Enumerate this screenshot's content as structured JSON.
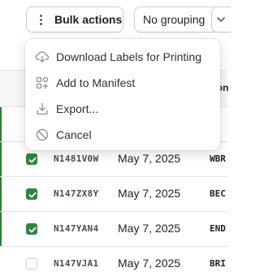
{
  "toolbar": {
    "bulk_actions_label": "Bulk actions",
    "grouping_label": "No grouping"
  },
  "menu": {
    "items": [
      {
        "label": "Download Labels for Printing",
        "icon": "download-cloud-icon"
      },
      {
        "label": "Add to Manifest",
        "icon": "manifest-grid-icon"
      },
      {
        "label": "Export...",
        "icon": "export-icon"
      },
      {
        "label": "Cancel",
        "icon": "cancel-icon"
      }
    ]
  },
  "table": {
    "header_partial": "Con",
    "rows": [
      {
        "id": "",
        "date": "",
        "customer": "",
        "selected": true,
        "checked": false
      },
      {
        "id": "N1481V0W",
        "date": "May 7, 2025",
        "customer": "WBR",
        "selected": true,
        "checked": true
      },
      {
        "id": "N147ZX8Y",
        "date": "May 7, 2025",
        "customer": "BEC",
        "selected": true,
        "checked": true
      },
      {
        "id": "N147YAN4",
        "date": "May 7, 2025",
        "customer": "END",
        "selected": true,
        "checked": true
      },
      {
        "id": "N147VJA1",
        "date": "May 7, 2025",
        "customer": "BRI",
        "selected": false,
        "checked": false
      }
    ]
  },
  "colors": {
    "checkbox_checked": "#2e8540",
    "selection_bar": "#2e7d32",
    "header_bg": "#f6f6f7"
  }
}
